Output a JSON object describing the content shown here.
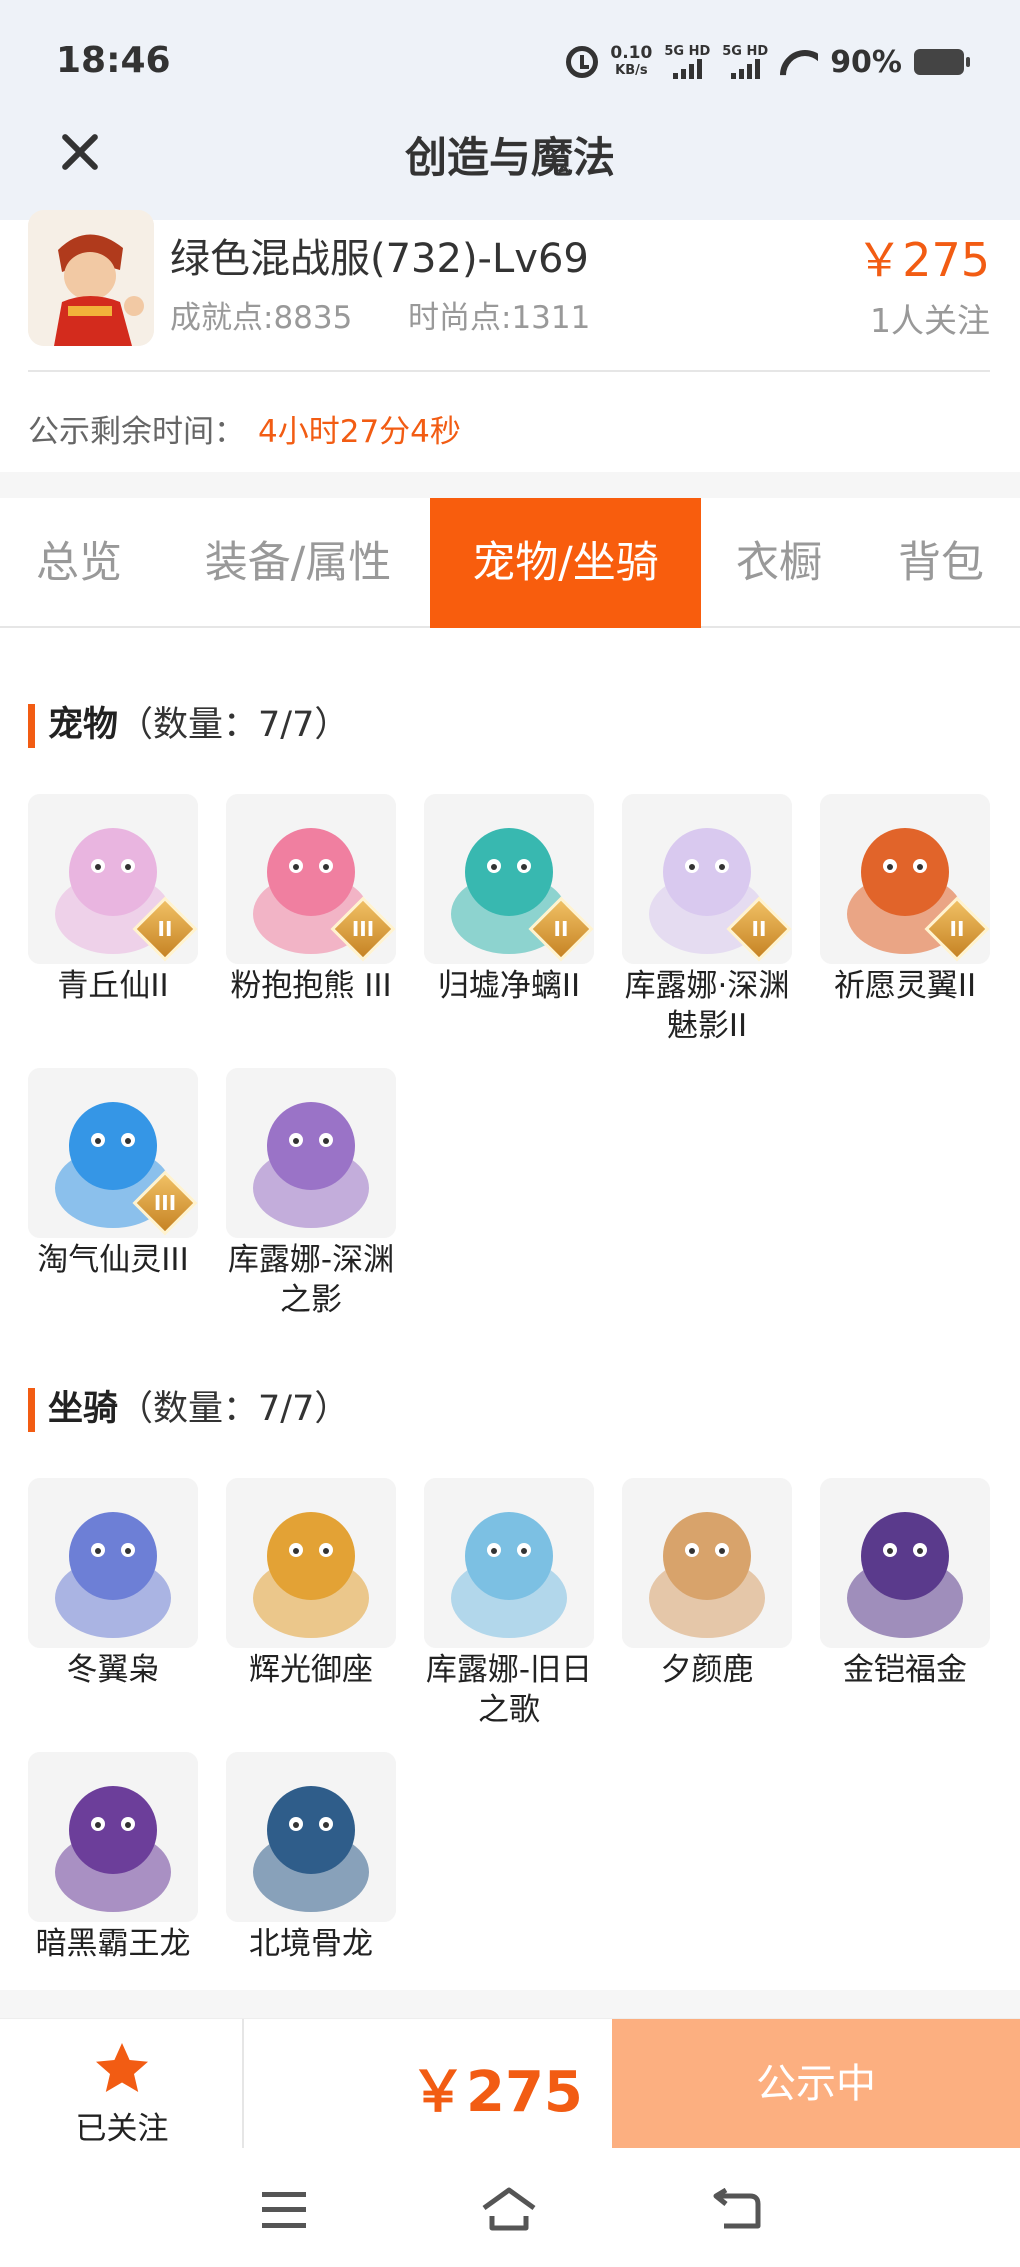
{
  "status_bar": {
    "time": "18:46",
    "speed_value": "0.10",
    "speed_unit": "KB/s",
    "sim1": "5G HD",
    "sim2": "5G HD",
    "battery": "90%"
  },
  "header": {
    "title": "创造与魔法"
  },
  "listing": {
    "name": "绿色混战服(732)-Lv69",
    "achievement": "成就点:8835",
    "fashion": "时尚点:1311",
    "price": "￥275",
    "followers": "1人关注",
    "remaining_label": "公示剩余时间：",
    "remaining_value": "4小时27分4秒"
  },
  "tabs": [
    {
      "label": "总览",
      "active": false
    },
    {
      "label": "装备/属性",
      "active": false
    },
    {
      "label": "宠物/坐骑",
      "active": true
    },
    {
      "label": "衣橱",
      "active": false
    },
    {
      "label": "背包",
      "active": false
    }
  ],
  "pets": {
    "title": "宠物",
    "count": "（数量：7/7）",
    "items": [
      {
        "name": "青丘仙II",
        "badge": "II",
        "icon": "pink-fox-fairy-icon",
        "color": "#e9b5e0"
      },
      {
        "name": "粉抱抱熊 III",
        "badge": "III",
        "icon": "pink-bear-icon",
        "color": "#f07fa0"
      },
      {
        "name": "归墟净螭II",
        "badge": "II",
        "icon": "teal-dragon-icon",
        "color": "#38b8b0"
      },
      {
        "name": "库露娜·深渊魅影II",
        "badge": "II",
        "icon": "white-hair-fairy-icon",
        "color": "#d9c9ef"
      },
      {
        "name": "祈愿灵翼II",
        "badge": "II",
        "icon": "fire-griffin-icon",
        "color": "#e1642a"
      },
      {
        "name": "淘气仙灵III",
        "badge": "III",
        "icon": "blue-dog-spirit-icon",
        "color": "#3596e6"
      },
      {
        "name": "库露娜-深渊之影",
        "badge": "",
        "icon": "purple-fluffy-girl-icon",
        "color": "#9a73c7"
      }
    ]
  },
  "mounts": {
    "title": "坐骑",
    "count": "（数量：7/7）",
    "items": [
      {
        "name": "冬翼枭",
        "icon": "snow-owl-icon",
        "color": "#6d7fd6"
      },
      {
        "name": "辉光御座",
        "icon": "golden-throne-icon",
        "color": "#e3a235"
      },
      {
        "name": "库露娜-旧日之歌",
        "icon": "blue-fluffy-girl-icon",
        "color": "#7cc0e3"
      },
      {
        "name": "夕颜鹿",
        "icon": "blossom-deer-icon",
        "color": "#d8a36b"
      },
      {
        "name": "金铠福金",
        "icon": "armored-beast-icon",
        "color": "#5a3a8c"
      },
      {
        "name": "暗黑霸王龙",
        "icon": "dark-trex-icon",
        "color": "#6c3e9a"
      },
      {
        "name": "北境骨龙",
        "icon": "bone-dragon-icon",
        "color": "#2f5d8a"
      }
    ]
  },
  "bottom_bar": {
    "follow_label": "已关注",
    "price": "￥275",
    "action": "公示中"
  }
}
